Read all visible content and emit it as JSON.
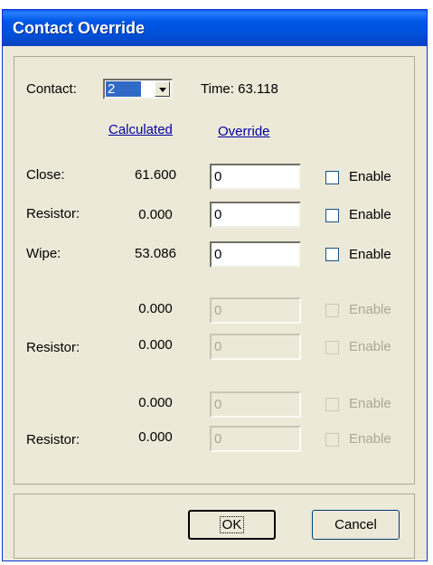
{
  "window": {
    "title": "Contact Override"
  },
  "contact": {
    "label": "Contact:",
    "value": "2",
    "time": "Time: 63.118"
  },
  "headers": {
    "calculated": "Calculated",
    "override": "Override"
  },
  "rows": [
    {
      "label": "Close:",
      "calculated": "61.600",
      "override": "0",
      "enable": "Enable"
    },
    {
      "label": "Resistor:",
      "calculated": "0.000",
      "override": "0",
      "enable": "Enable"
    },
    {
      "label": "Wipe:",
      "calculated": "53.086",
      "override": "0",
      "enable": "Enable"
    },
    {
      "label": "",
      "calculated": "0.000",
      "override": "0",
      "enable": "Enable"
    },
    {
      "label": "Resistor:",
      "calculated": "0.000",
      "override": "0",
      "enable": "Enable"
    },
    {
      "label": "",
      "calculated": "0.000",
      "override": "0",
      "enable": "Enable"
    },
    {
      "label": "Resistor:",
      "calculated": "0.000",
      "override": "0",
      "enable": "Enable"
    }
  ],
  "buttons": {
    "ok": "OK",
    "cancel": "Cancel"
  }
}
